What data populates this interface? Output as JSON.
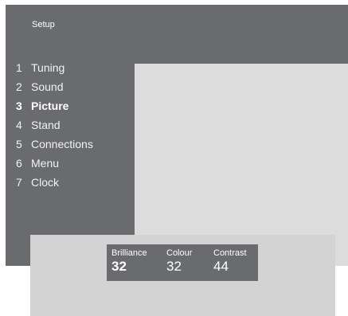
{
  "menu": {
    "title": "Setup",
    "items": [
      {
        "number": "1",
        "label": "Tuning"
      },
      {
        "number": "2",
        "label": "Sound"
      },
      {
        "number": "3",
        "label": "Picture",
        "active": true
      },
      {
        "number": "4",
        "label": "Stand"
      },
      {
        "number": "5",
        "label": "Connections"
      },
      {
        "number": "6",
        "label": "Menu"
      },
      {
        "number": "7",
        "label": "Clock"
      }
    ]
  },
  "picture": {
    "settings": [
      {
        "label": "Brilliance",
        "value": "32",
        "selected": true
      },
      {
        "label": "Colour",
        "value": "32"
      },
      {
        "label": "Contrast",
        "value": "44"
      }
    ]
  },
  "colors": {
    "menu_background": "#6a6b6f",
    "preview_background": "#dcdcdc",
    "bottom_panel_background": "#d3d3d3",
    "text": "#ffffff"
  }
}
